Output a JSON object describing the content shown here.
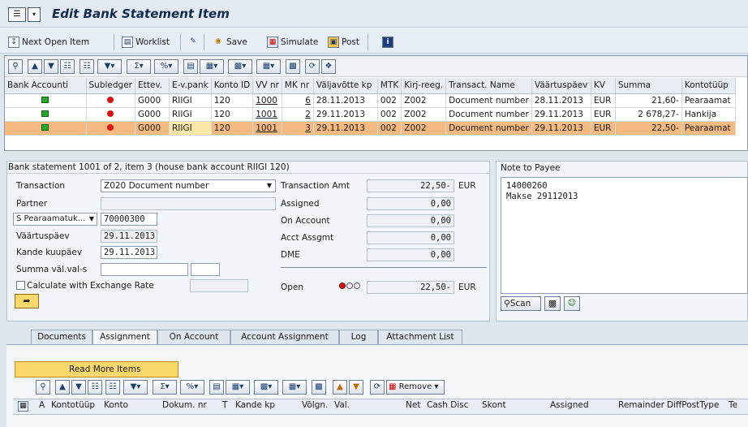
{
  "window": {
    "title": "Edit Bank Statement Item"
  },
  "toolbar": {
    "next_open_item": "Next Open Item",
    "worklist": "Worklist",
    "save": "Save",
    "simulate": "Simulate",
    "post": "Post"
  },
  "statement_grid": {
    "columns": [
      "Bank Accounti",
      "Subledger",
      "Ettev.",
      "E-v.pank",
      "Konto ID",
      "VV nr",
      "MK nr",
      "Väljavõtte kp",
      "MTK",
      "Kirj-reeg.",
      "Transact. Name",
      "Väärtuspäev",
      "KV",
      "Summa",
      "Kontotüüp"
    ],
    "rows": [
      {
        "ettev": "G000",
        "evpank": "RIIGI",
        "konto_id": "120",
        "vv_nr": "1000",
        "mk_nr": "6",
        "valjavotte_kp": "28.11.2013",
        "mtk": "002",
        "kirj_reeg": "Z002",
        "transact_name": "Document number",
        "vaartuspaev": "28.11.2013",
        "kv": "EUR",
        "summa": "21,60-",
        "kontotuup": "Pearaamat"
      },
      {
        "ettev": "G000",
        "evpank": "RIIGI",
        "konto_id": "120",
        "vv_nr": "1001",
        "mk_nr": "2",
        "valjavotte_kp": "29.11.2013",
        "mtk": "002",
        "kirj_reeg": "Z002",
        "transact_name": "Document number",
        "vaartuspaev": "29.11.2013",
        "kv": "EUR",
        "summa": "2 678,27-",
        "kontotuup": "Hankija"
      },
      {
        "ettev": "G000",
        "evpank": "RIIGI",
        "konto_id": "120",
        "vv_nr": "1001",
        "mk_nr": "3",
        "valjavotte_kp": "29.11.2013",
        "mtk": "002",
        "kirj_reeg": "Z002",
        "transact_name": "Document number",
        "vaartuspaev": "29.11.2013",
        "kv": "EUR",
        "summa": "22,50-",
        "kontotuup": "Pearaamat"
      }
    ]
  },
  "detail": {
    "header": "Bank statement 1001 of 2, item 3 (house bank account RIIGI 120)",
    "transaction_label": "Transaction",
    "transaction_value": "Z020 Document number",
    "partner_label": "Partner",
    "partner_value": "",
    "account_type_value": "S Pearaamatuk...",
    "account_value": "70000300",
    "vaartuspaev_label": "Väärtuspäev",
    "vaartuspaev_value": "29.11.2013",
    "kande_label": "Kande kuupäev",
    "kande_value": "29.11.2013",
    "summa_label": "Summa väl.val-s",
    "calc_label": "Calculate with Exchange Rate",
    "transaction_amt_label": "Transaction Amt",
    "transaction_amt_value": "22,50-",
    "transaction_amt_cur": "EUR",
    "assigned_label": "Assigned",
    "assigned_value": "0,00",
    "on_account_label": "On Account",
    "on_account_value": "0,00",
    "acct_assgmt_label": "Acct Assgmt",
    "acct_assgmt_value": "0,00",
    "dme_label": "DME",
    "dme_value": "0,00",
    "open_label": "Open",
    "open_value": "22,50-",
    "open_cur": "EUR"
  },
  "note": {
    "title": "Note to Payee",
    "line1": "14000260",
    "line2": "Makse 29112013",
    "scan_label": "Scan"
  },
  "tabs": [
    "Documents",
    "Assignment",
    "On Account",
    "Account Assignment",
    "Log",
    "Attachment List"
  ],
  "assignment": {
    "read_more": "Read More Items",
    "remove": "Remove",
    "columns": [
      "A",
      "Kontotüüp",
      "Konto",
      "Dokum. nr",
      "T",
      "Kande kp",
      "Võlgn.",
      "Val.",
      "Net",
      "Cash Disc",
      "Skont",
      "Assigned",
      "Remainder",
      "DiffPostType",
      "Te"
    ]
  }
}
